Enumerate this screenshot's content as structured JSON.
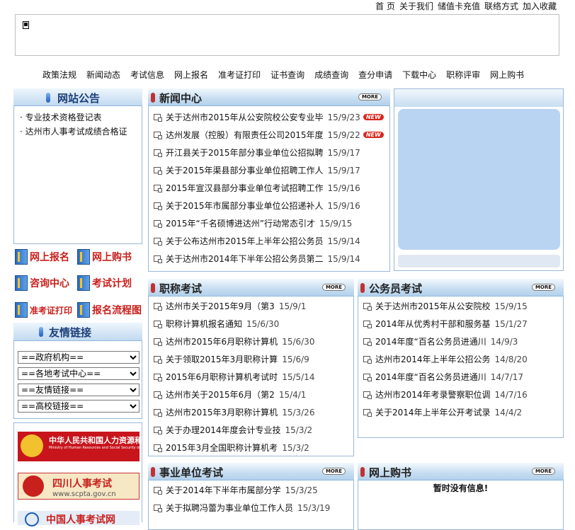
{
  "top_links": [
    "首 页",
    "关于我们",
    "储值卡充值",
    "联络方式",
    "加入收藏"
  ],
  "nav": [
    "政策法规",
    "新闻动态",
    "考试信息",
    "网上报名",
    "准考证打印",
    "证书查询",
    "成绩查询",
    "查分申请",
    "下载中心",
    "职称评审",
    "网上购书"
  ],
  "announce": {
    "title": "网站公告",
    "items": [
      "专业技术资格登记表",
      "达州市人事考试成绩合格证"
    ]
  },
  "quick": [
    "网上报名",
    "网上购书",
    "咨询中心",
    "考试计划",
    "准考证打印",
    "报名流程图"
  ],
  "friends": {
    "title": "友情链接",
    "selects": [
      "==政府机构==",
      "==各地考试中心==",
      "==友情链接==",
      "==高校链接=="
    ]
  },
  "logos": [
    "中华人民共和国人力资源和社会保障部",
    "Ministry of Human Resources and Social Security of the People's Republic of China",
    "四川人事考试",
    "www.scpta.gov.cn",
    "中国人事考试网"
  ],
  "more_label": "MORE",
  "news": {
    "title": "新闻中心",
    "new_label": "NEW",
    "items": [
      {
        "t": "关于达州市2015年从公安院校公安专业毕",
        "d": "15/9/23",
        "new": true
      },
      {
        "t": "达州发展（控股）有限责任公司2015年度",
        "d": "15/9/22",
        "new": true
      },
      {
        "t": "开江县关于2015年部分事业单位公招拟聘",
        "d": "15/9/17"
      },
      {
        "t": "关于2015年渠县部分事业单位招聘工作人",
        "d": "15/9/17"
      },
      {
        "t": "2015年宣汉县部分事业单位考试招聘工作",
        "d": "15/9/16"
      },
      {
        "t": "关于2015年市属部分事业单位公招递补人",
        "d": "15/9/16"
      },
      {
        "t": "2015年“千名硕博进达州”行动常态引才",
        "d": "15/9/15"
      },
      {
        "t": "关于公布达州市2015年上半年公招公务员",
        "d": "15/9/14"
      },
      {
        "t": "关于达州市2014年下半年公招公务员第二",
        "d": "15/9/14"
      }
    ]
  },
  "title_exam": {
    "title": "职称考试",
    "items": [
      {
        "t": "达州市关于2015年9月（第3",
        "d": "15/9/1"
      },
      {
        "t": "职称计算机报名通知",
        "d": "15/6/30"
      },
      {
        "t": "达州市2015年6月职称计算机",
        "d": "15/6/30"
      },
      {
        "t": "关于领取2015年3月职称计算",
        "d": "15/6/9"
      },
      {
        "t": "2015年6月职称计算机考试时",
        "d": "15/5/14"
      },
      {
        "t": "达州市关于2015年6月（第2",
        "d": "15/4/1"
      },
      {
        "t": "达州市2015年3月职称计算机",
        "d": "15/3/26"
      },
      {
        "t": "关于办理2014年度会计专业技",
        "d": "15/3/2"
      },
      {
        "t": "2015年3月全国职称计算机考",
        "d": "15/3/2"
      }
    ]
  },
  "civil": {
    "title": "公务员考试",
    "items": [
      {
        "t": "关于达州市2015年从公安院校",
        "d": "15/9/15"
      },
      {
        "t": "2014年从优秀村干部和服务基",
        "d": "15/1/27"
      },
      {
        "t": "2014年度“百名公务员进通川",
        "d": "14/9/3"
      },
      {
        "t": "达州市2014年上半年公招公务",
        "d": "14/8/20"
      },
      {
        "t": "2014年度“百名公务员进通川",
        "d": "14/7/17"
      },
      {
        "t": "达州市2014年考录警察职位调",
        "d": "14/7/16"
      },
      {
        "t": "关于2014年上半年公开考试录",
        "d": "14/4/2"
      }
    ]
  },
  "public_inst": {
    "title": "事业单位考试",
    "items": [
      {
        "t": "关于2014年下半年市属部分学",
        "d": "15/3/25"
      },
      {
        "t": "关于拟聘冯蕾为事业单位工作人员",
        "d": "15/3/19"
      }
    ]
  },
  "books": {
    "title": "网上购书",
    "empty": "暂时没有信息!"
  },
  "colors": {
    "title_bar": "#c6ddf1",
    "border": "#9ab9d9",
    "accent_red": "#c8201c",
    "video_bg": "#b9d3f3"
  }
}
